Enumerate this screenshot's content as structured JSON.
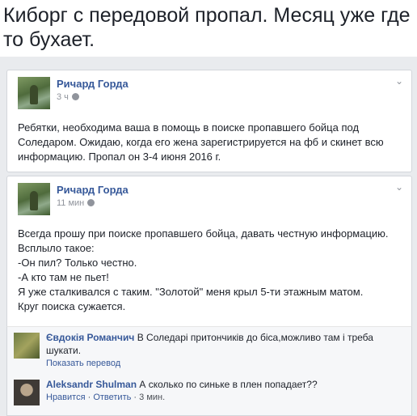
{
  "headline": "Киборг с передовой пропал. Месяц уже где то бухает.",
  "post1": {
    "author": "Ричард Горда",
    "time": "3 ч",
    "text": "Ребятки, необходима ваша в помощь в поиске пропавшего бойца под Соледаром. Ожидаю, когда его жена зарегистрируется на фб и скинет всю информацию. Пропал он 3-4 июня 2016 г."
  },
  "post2": {
    "author": "Ричард Горда",
    "time": "11 мин",
    "lines": [
      "Всегда прошу при поиске пропавшего бойца, давать честную информацию. Всплыло такое:",
      "-Он пил? Только честно.",
      "-А кто там не пьет!",
      "Я уже сталкивался с таким. \"Золотой\" меня крыл 5-ти этажным матом.",
      "Круг поиска сужается."
    ]
  },
  "comments": [
    {
      "name": "Євдокія Романчич",
      "text": "В Соледарі притончиків до біса,можливо там і треба шукати.",
      "action": "Показать перевод"
    },
    {
      "name": "Aleksandr Shulman",
      "text": "А сколько по синьке в плен попадает??",
      "like": "Нравится",
      "reply": "Ответить",
      "time": "3 мин."
    }
  ],
  "separator": " · "
}
